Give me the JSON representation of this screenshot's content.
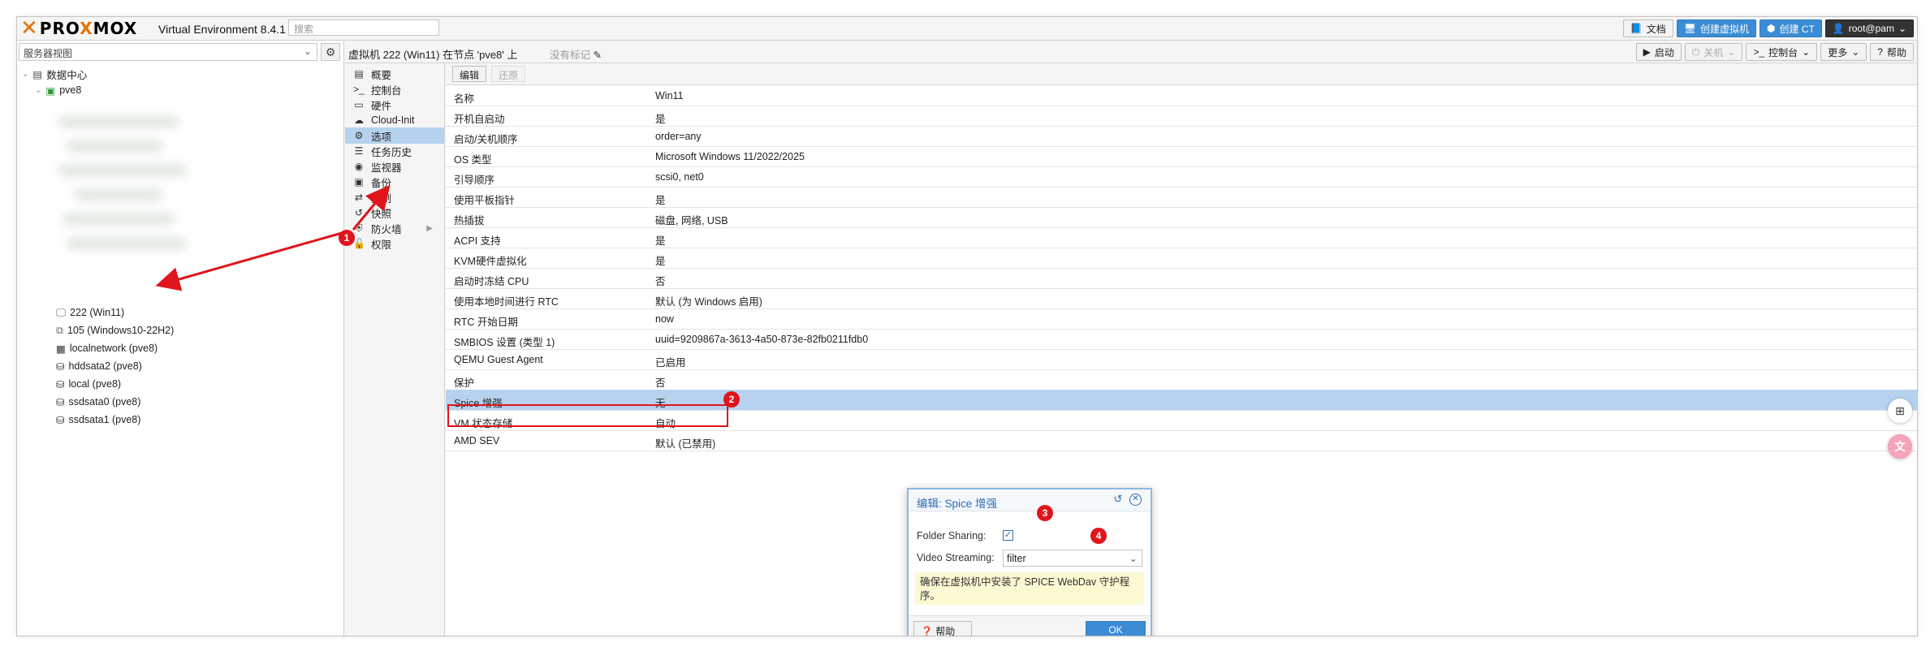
{
  "app": {
    "logo_prefix": "PRO",
    "logo_o": "X",
    "logo_suffix": "MO",
    "logo_end": "X",
    "product": "Virtual Environment 8.4.1",
    "search_placeholder": "搜索"
  },
  "header_buttons": {
    "docs": "文档",
    "create_vm": "创建虚拟机",
    "create_ct": "创建 CT",
    "user": "root@pam"
  },
  "left": {
    "view_select": "服务器视图",
    "datacenter": "数据中心",
    "node": "pve8",
    "items": [
      {
        "label": "222 (Win11)",
        "icon": "monitor-icon"
      },
      {
        "label": "105 (Windows10-22H2)",
        "icon": "template-icon"
      },
      {
        "label": "localnetwork (pve8)",
        "icon": "grid-icon"
      },
      {
        "label": "hddsata2 (pve8)",
        "icon": "storage-icon"
      },
      {
        "label": "local (pve8)",
        "icon": "storage-icon"
      },
      {
        "label": "ssdsata0 (pve8)",
        "icon": "storage-icon"
      },
      {
        "label": "ssdsata1 (pve8)",
        "icon": "storage-icon"
      }
    ]
  },
  "content_header": {
    "title": "虚拟机 222 (Win11) 在节点 'pve8' 上",
    "no_tags": "没有标记",
    "actions": {
      "start": "启动",
      "shutdown": "关机",
      "console": "控制台",
      "more": "更多",
      "help": "帮助"
    }
  },
  "subnav": [
    {
      "label": "概要",
      "icon": "book-icon"
    },
    {
      "label": "控制台",
      "icon": "terminal-icon"
    },
    {
      "label": "硬件",
      "icon": "desktop-icon"
    },
    {
      "label": "Cloud-Init",
      "icon": "cloud-icon"
    },
    {
      "label": "选项",
      "icon": "gear-icon",
      "selected": true
    },
    {
      "label": "任务历史",
      "icon": "list-icon"
    },
    {
      "label": "监视器",
      "icon": "eye-icon"
    },
    {
      "label": "备份",
      "icon": "save-icon"
    },
    {
      "label": "复制",
      "icon": "retweet-icon"
    },
    {
      "label": "快照",
      "icon": "history-icon"
    },
    {
      "label": "防火墙",
      "icon": "shield-icon"
    },
    {
      "label": "权限",
      "icon": "unlock-icon"
    }
  ],
  "toolbar": {
    "edit": "编辑",
    "revert": "还原"
  },
  "options": [
    {
      "key": "名称",
      "value": "Win11"
    },
    {
      "key": "开机自启动",
      "value": "是"
    },
    {
      "key": "启动/关机顺序",
      "value": "order=any"
    },
    {
      "key": "OS 类型",
      "value": "Microsoft Windows 11/2022/2025"
    },
    {
      "key": "引导顺序",
      "value": "scsi0, net0"
    },
    {
      "key": "使用平板指针",
      "value": "是"
    },
    {
      "key": "热插拔",
      "value": "磁盘, 网络, USB"
    },
    {
      "key": "ACPI 支持",
      "value": "是"
    },
    {
      "key": "KVM硬件虚拟化",
      "value": "是"
    },
    {
      "key": "启动时冻结 CPU",
      "value": "否"
    },
    {
      "key": "使用本地时间进行 RTC",
      "value": "默认 (为 Windows 启用)"
    },
    {
      "key": "RTC 开始日期",
      "value": "now"
    },
    {
      "key": "SMBIOS 设置 (类型 1)",
      "value": "uuid=9209867a-3613-4a50-873e-82fb0211fdb0"
    },
    {
      "key": "QEMU Guest Agent",
      "value": "已启用"
    },
    {
      "key": "保护",
      "value": "否"
    },
    {
      "key": "Spice 增强",
      "value": "无",
      "selected": true
    },
    {
      "key": "VM 状态存储",
      "value": "自动"
    },
    {
      "key": "AMD SEV",
      "value": "默认 (已禁用)"
    }
  ],
  "dialog": {
    "title": "编辑: Spice 增强",
    "folder_sharing_label": "Folder Sharing:",
    "video_streaming_label": "Video Streaming:",
    "video_streaming_value": "filter",
    "note": "确保在虚拟机中安装了 SPICE WebDav 守护程序。",
    "help": "帮助",
    "ok": "OK"
  },
  "markers": [
    "1",
    "2",
    "3",
    "4"
  ],
  "colors": {
    "accent": "#e57000",
    "selection": "#b6d2ee",
    "primary_button": "#3a8dd5",
    "annotation_red": "#e0141c"
  }
}
